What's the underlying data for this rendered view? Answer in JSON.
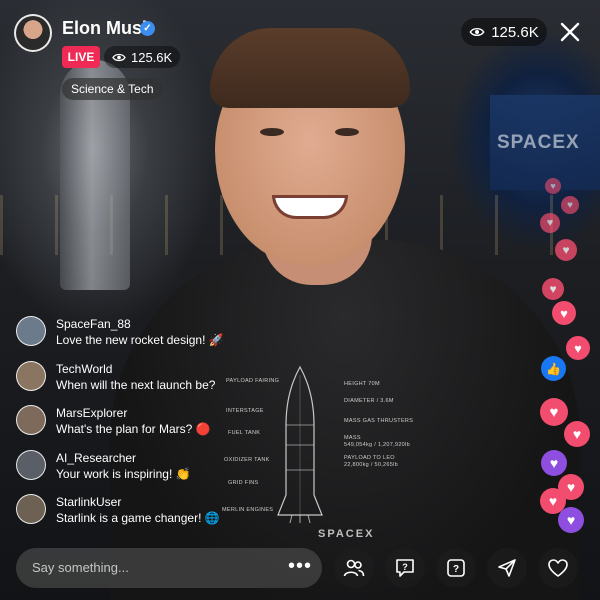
{
  "header": {
    "host_name": "Elon Musk",
    "live_label": "LIVE",
    "viewer_count": "125.6K",
    "category": "Science & Tech",
    "top_viewer_count": "125.6K"
  },
  "background": {
    "wall_logo": "SPACEX"
  },
  "shirt": {
    "labels": [
      "PAYLOAD FAIRING",
      "INTERSTAGE",
      "FUEL TANK",
      "OXIDIZER TANK",
      "GRID FINS",
      "MERLIN ENGINES",
      "HEIGHT 70M",
      "DIAMETER / 3.6M",
      "MASS GAS THRUSTERS",
      "MASS",
      "549,054kg / 1,207,920lb",
      "PAYLOAD TO LEO",
      "22,800kg / 50,265lb"
    ],
    "logo": "SPACEX"
  },
  "comments": [
    {
      "user": "SpaceFan_88",
      "text": "Love the new rocket design! 🚀",
      "avatar_color": "#6b7b8c"
    },
    {
      "user": "TechWorld",
      "text": "When will the next launch be?",
      "avatar_color": "#8a7560"
    },
    {
      "user": "MarsExplorer",
      "text": "What's the plan for Mars? 🔴",
      "avatar_color": "#7d6a5a"
    },
    {
      "user": "AI_Researcher",
      "text": "Your work is inspiring! 👏",
      "avatar_color": "#5a5e66"
    },
    {
      "user": "StarlinkUser",
      "text": "Starlink is a game changer! 🌐",
      "avatar_color": "#6d6154"
    }
  ],
  "composer": {
    "placeholder": "Say something..."
  },
  "icons": {
    "close": "close-icon",
    "eye": "eye-icon",
    "verified": "verified-badge-icon",
    "guests": "guests-icon",
    "qa": "question-bubble-icon",
    "help": "question-box-icon",
    "share": "send-icon",
    "like": "heart-icon"
  },
  "colors": {
    "live": "#ee2a55",
    "verified": "#3b8ef0",
    "heart_pink": "#f24c6e",
    "heart_purple": "#8e4fe0",
    "like_blue": "#1877f2"
  }
}
